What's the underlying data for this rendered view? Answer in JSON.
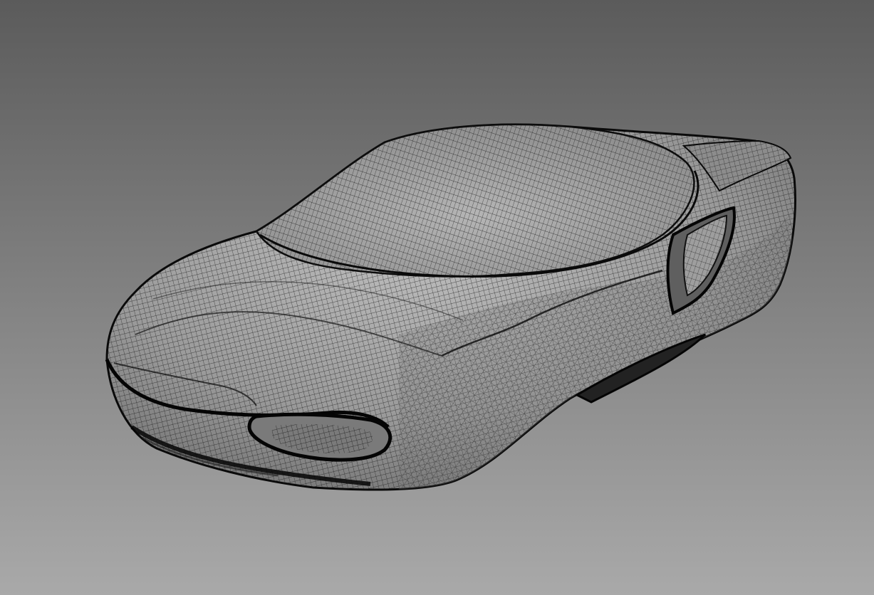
{
  "viewport": {
    "background_top": "#5b5b5b",
    "background_bottom": "#a9a9a9",
    "mesh_surface": "#9a9a9a",
    "mesh_highlight": "#bdbdbd",
    "wire_color": "#111111"
  },
  "model": {
    "icon": "car-mesh-icon",
    "render_mode": "wireframe-on-shaded"
  }
}
